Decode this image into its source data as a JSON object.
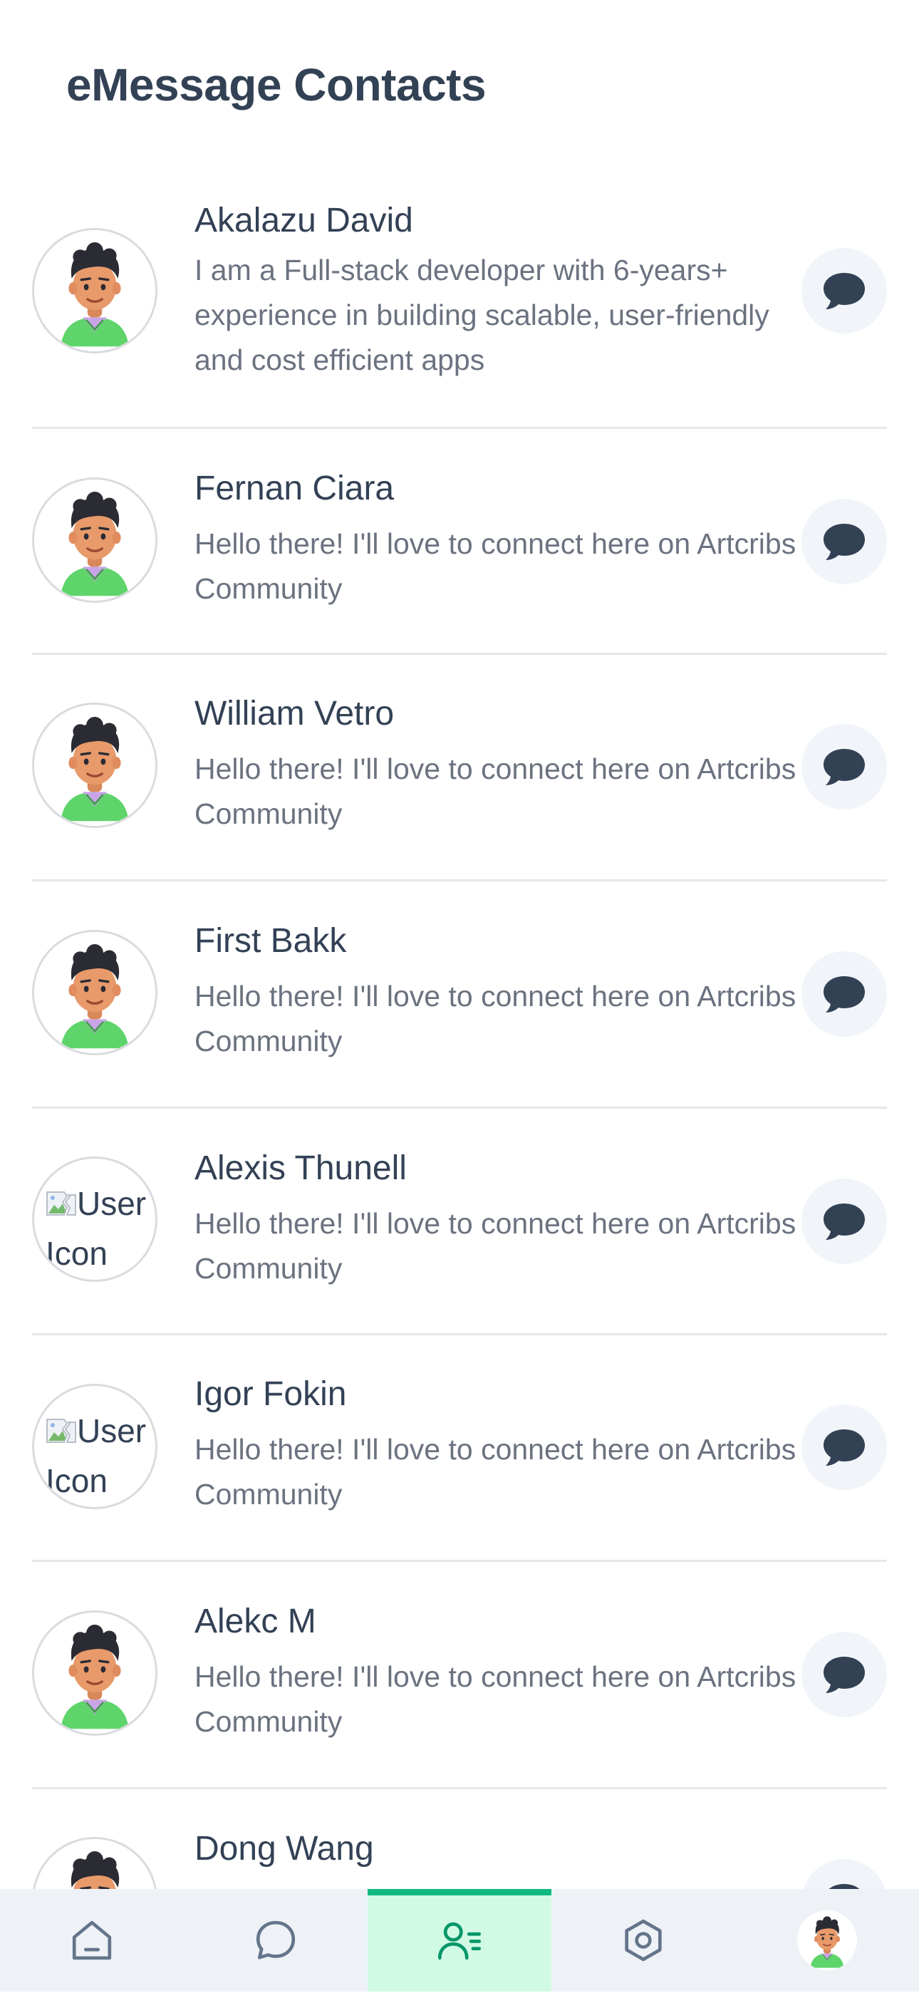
{
  "header": {
    "title": "eMessage Contacts"
  },
  "contacts": [
    {
      "name": "Akalazu David",
      "bio": "I am a Full-stack developer with 6-years+ experience in building scalable, user-friendly and cost efficient apps",
      "avatar": "memoji-avatar"
    },
    {
      "name": "Fernan Ciara",
      "bio": "Hello there! I'll love to connect here on Artcribs Community",
      "avatar": "memoji-avatar"
    },
    {
      "name": "William Vetro",
      "bio": "Hello there! I'll love to connect here on Artcribs Community",
      "avatar": "memoji-avatar"
    },
    {
      "name": "First Bakk",
      "bio": "Hello there! I'll love to connect here on Artcribs Community",
      "avatar": "memoji-avatar"
    },
    {
      "name": "Alexis Thunell",
      "bio": "Hello there! I'll love to connect here on Artcribs Community",
      "avatar": "broken-image",
      "avatar_alt": "User Icon"
    },
    {
      "name": "Igor Fokin",
      "bio": "Hello there! I'll love to connect here on Artcribs Community",
      "avatar": "broken-image",
      "avatar_alt": "User Icon"
    },
    {
      "name": "Alekc M",
      "bio": "Hello there! I'll love to connect here on Artcribs Community",
      "avatar": "memoji-avatar"
    },
    {
      "name": "Dong Wang",
      "bio": "",
      "avatar": "memoji-avatar"
    }
  ],
  "tabbar": {
    "tabs": [
      {
        "id": "home",
        "icon": "home-icon",
        "active": false
      },
      {
        "id": "chats",
        "icon": "chat-bubble-icon",
        "active": false
      },
      {
        "id": "contacts",
        "icon": "contacts-icon",
        "active": true
      },
      {
        "id": "settings",
        "icon": "settings-hexagon-icon",
        "active": false
      },
      {
        "id": "profile",
        "icon": "profile-avatar",
        "active": false
      }
    ],
    "accent": "#10b981",
    "active_bg": "#d1fae5"
  },
  "colors": {
    "title": "#334155",
    "bio": "#6b7280",
    "chat_button_bg": "#f1f5f9",
    "chat_icon": "#334155",
    "divider": "#e5e7eb"
  }
}
